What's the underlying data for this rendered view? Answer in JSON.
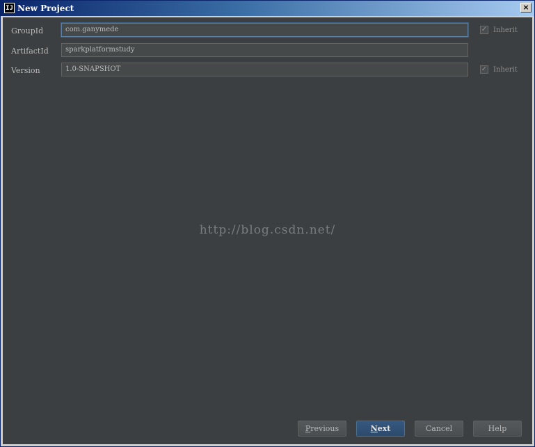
{
  "window": {
    "title": "New Project",
    "app_icon_text": "IJ",
    "close_glyph": "×"
  },
  "form": {
    "group_id": {
      "label": "GroupId",
      "value": "com.ganymede",
      "inherit_label": "Inherit",
      "inherit_checked": true
    },
    "artifact_id": {
      "label": "ArtifactId",
      "value": "sparkplatformstudy"
    },
    "version": {
      "label": "Version",
      "value": "1.0-SNAPSHOT",
      "inherit_label": "Inherit",
      "inherit_checked": true
    }
  },
  "watermark": "http://blog.csdn.net/",
  "buttons": {
    "previous": {
      "mnemonic": "P",
      "rest": "revious"
    },
    "next": {
      "mnemonic": "N",
      "rest": "ext"
    },
    "cancel": "Cancel",
    "help": "Help"
  },
  "colors": {
    "background": "#3c3f41",
    "field_bg": "#45494a",
    "focus_border": "#5a7ea6",
    "primary_button": "#365880"
  }
}
